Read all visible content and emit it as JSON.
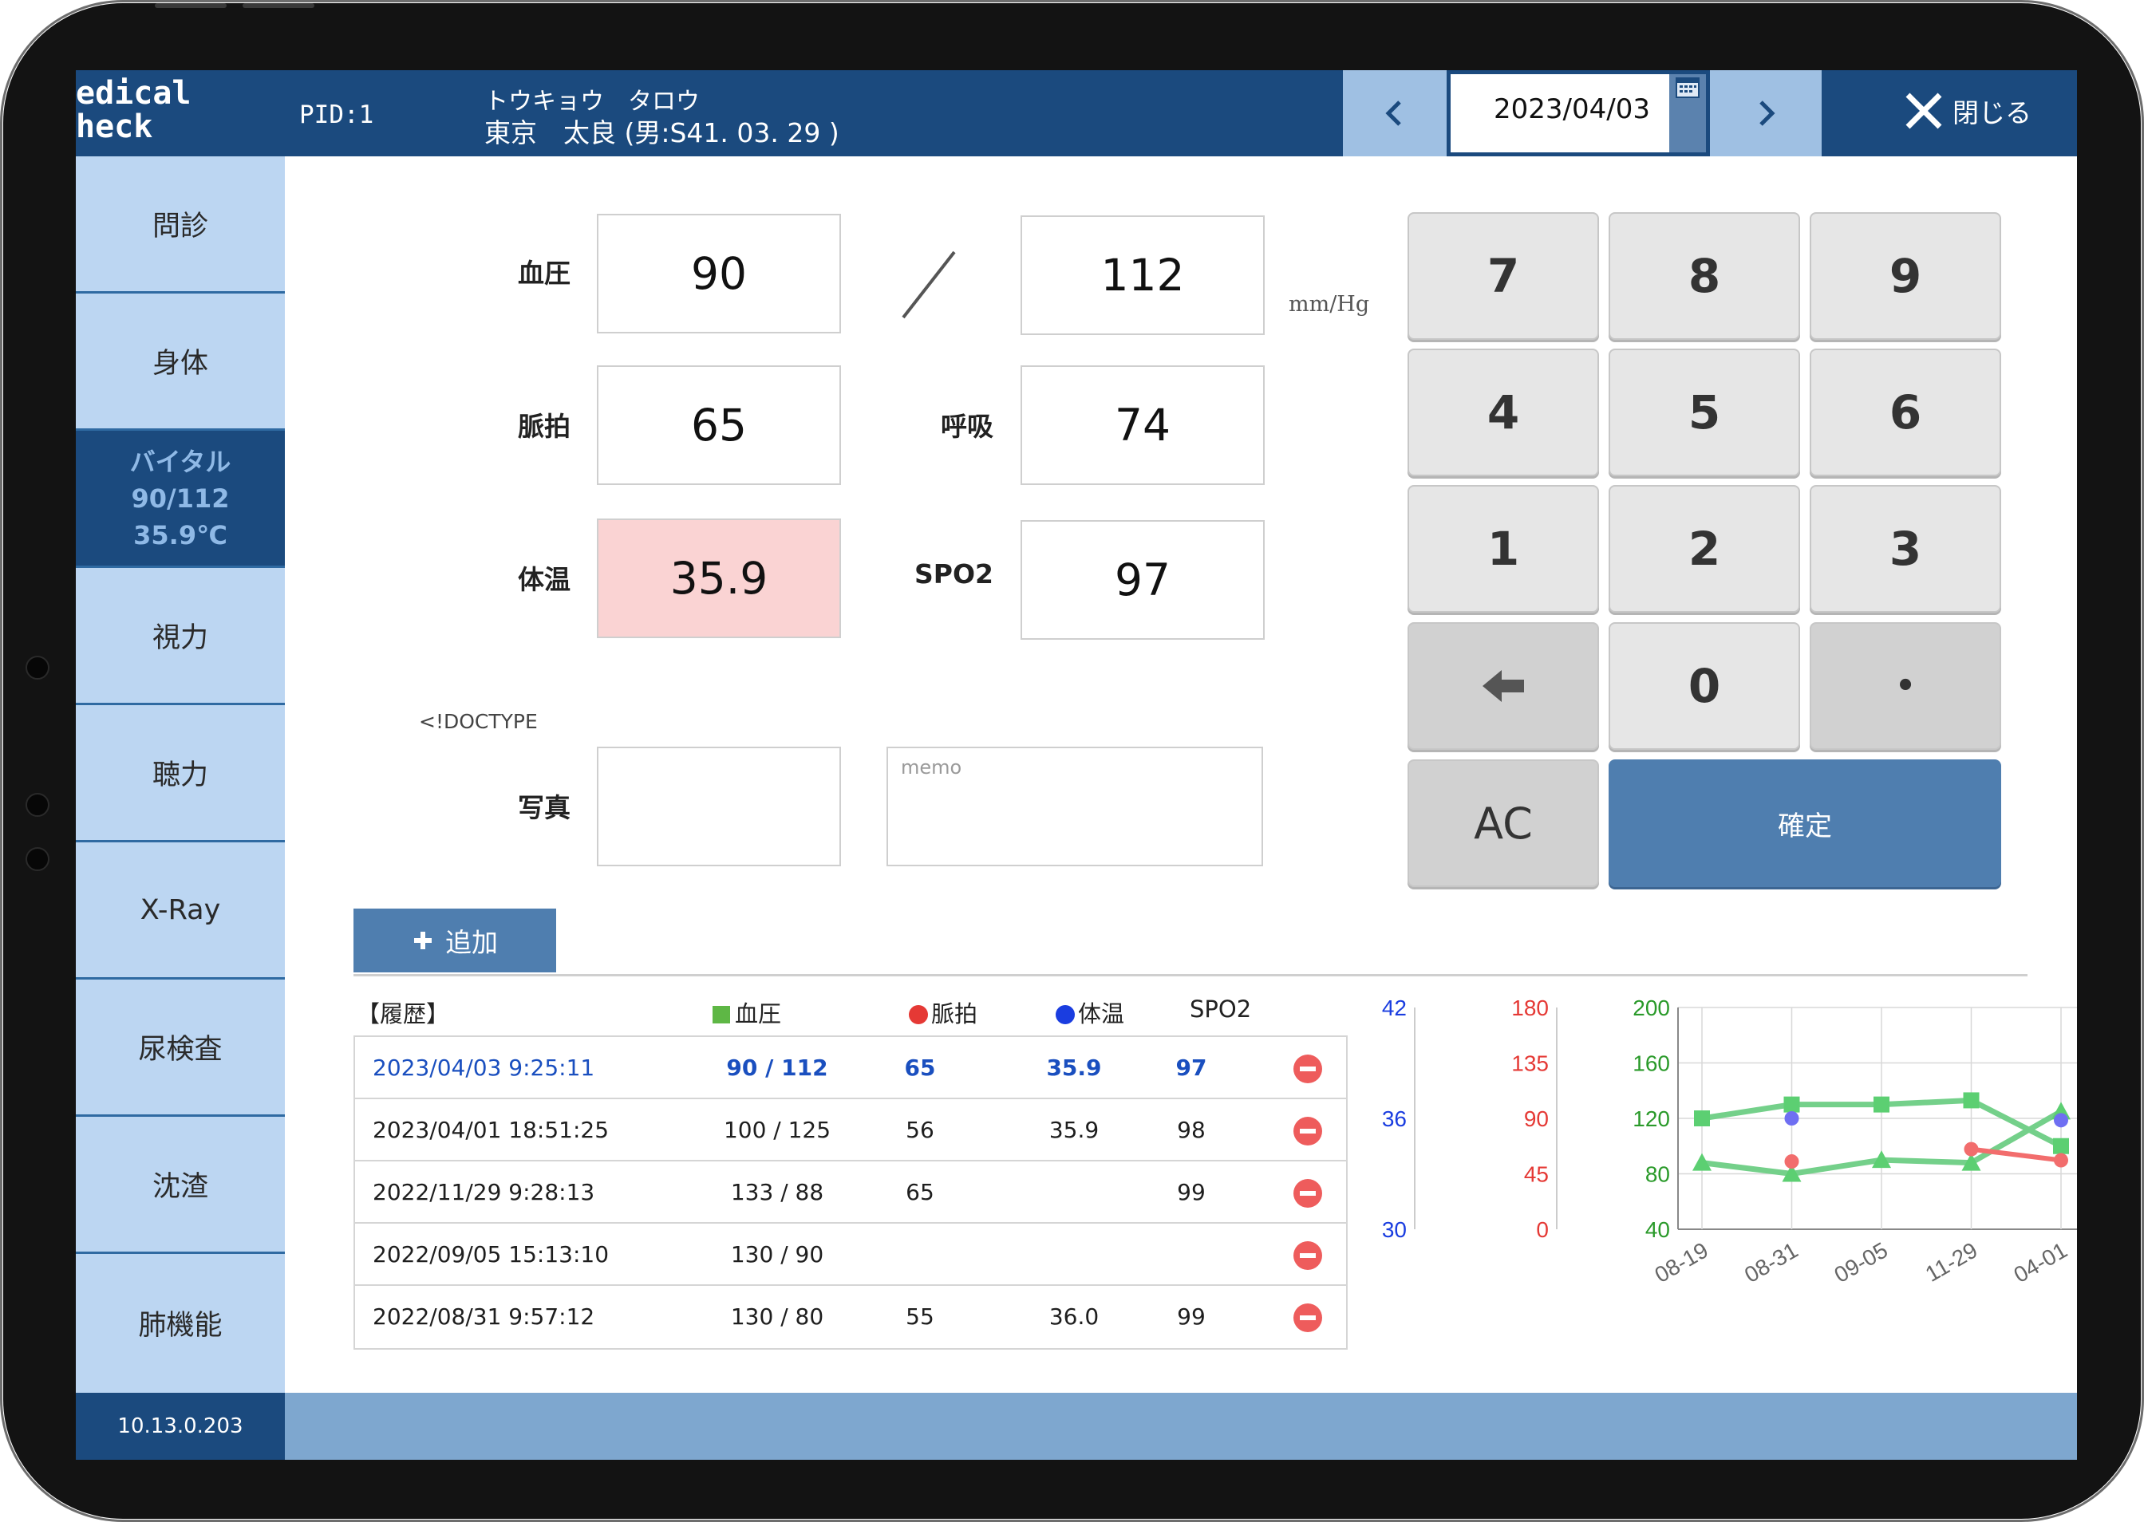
{
  "header": {
    "logo": "edical\nheck",
    "pid": "PID:1",
    "patient_kana": "トウキョウ　タロウ",
    "patient_name": "東京　太良 (男:S41. 03. 29 )",
    "date": "2023/04/03",
    "close_label": "閉じる"
  },
  "sidebar": {
    "items": [
      {
        "label": "問診"
      },
      {
        "label": "身体"
      },
      {
        "label": "バイタル",
        "sub1": "90/112",
        "sub2": "35.9℃"
      },
      {
        "label": "視力"
      },
      {
        "label": "聴力"
      },
      {
        "label": "X-Ray"
      },
      {
        "label": "尿検査"
      },
      {
        "label": "沈渣"
      },
      {
        "label": "肺機能"
      }
    ],
    "ip": "10.13.0.203"
  },
  "form": {
    "bp_label": "血圧",
    "bp_low": "90",
    "bp_high": "112",
    "unit": "mm/Hg",
    "pulse_label": "脈拍",
    "pulse": "65",
    "resp_label": "呼吸",
    "resp": "74",
    "temp_label": "体温",
    "temp": "35.9",
    "spo2_label": "SPO2",
    "spo2": "97",
    "doctype": "<!DOCTYPE",
    "photo_label": "写真",
    "memo_placeholder": "memo"
  },
  "keypad": {
    "keys": [
      "7",
      "8",
      "9",
      "4",
      "5",
      "6",
      "1",
      "2",
      "3",
      "",
      "0",
      "•",
      "AC"
    ],
    "confirm": "確定"
  },
  "add_button": "追加",
  "history": {
    "title": "【履歴】",
    "col_bp": "血圧",
    "col_pulse": "脈拍",
    "col_temp": "体温",
    "col_spo2": "SPO2",
    "rows": [
      {
        "datetime": "2023/04/03 9:25:11",
        "bp": "90 / 112",
        "pulse": "65",
        "temp": "35.9",
        "spo2": "97"
      },
      {
        "datetime": "2023/04/01 18:51:25",
        "bp": "100 / 125",
        "pulse": "56",
        "temp": "35.9",
        "spo2": "98"
      },
      {
        "datetime": "2022/11/29 9:28:13",
        "bp": "133 / 88",
        "pulse": "65",
        "temp": "",
        "spo2": "99"
      },
      {
        "datetime": "2022/09/05 15:13:10",
        "bp": "130 / 90",
        "pulse": "",
        "temp": "",
        "spo2": ""
      },
      {
        "datetime": "2022/08/31 9:57:12",
        "bp": "130 / 80",
        "pulse": "55",
        "temp": "36.0",
        "spo2": "99"
      }
    ]
  },
  "colors": {
    "header": "#1b4a7e",
    "sidebar": "#bcd6f2",
    "alert": "#fad3d3",
    "bp": "#5eb745",
    "pulse": "#e53935",
    "temp": "#1a3de0"
  },
  "chart_data": {
    "type": "line",
    "categories": [
      "08-19",
      "08-31",
      "09-05",
      "11-29",
      "04-01"
    ],
    "axes": {
      "temp": {
        "ticks": [
          "42",
          "36",
          "30"
        ],
        "ylim": [
          30,
          42
        ]
      },
      "pulse": {
        "ticks": [
          "180",
          "135",
          "90",
          "45",
          "0"
        ],
        "ylim": [
          0,
          180
        ]
      },
      "bp": {
        "ticks": [
          "200",
          "160",
          "120",
          "80",
          "40"
        ],
        "ylim": [
          40,
          200
        ]
      }
    },
    "series": [
      {
        "name": "血圧",
        "axis": "bp",
        "marker": "square",
        "values": [
          120,
          130,
          130,
          133,
          100
        ]
      },
      {
        "name": "血圧",
        "axis": "bp",
        "marker": "triangle",
        "values": [
          88,
          80,
          90,
          88,
          125
        ]
      },
      {
        "name": "脈拍",
        "axis": "pulse",
        "marker": "circle",
        "values": [
          null,
          55,
          null,
          65,
          56
        ]
      },
      {
        "name": "体温",
        "axis": "temp",
        "marker": "circle",
        "values": [
          null,
          36.0,
          null,
          null,
          35.9
        ]
      }
    ],
    "grid": true
  }
}
